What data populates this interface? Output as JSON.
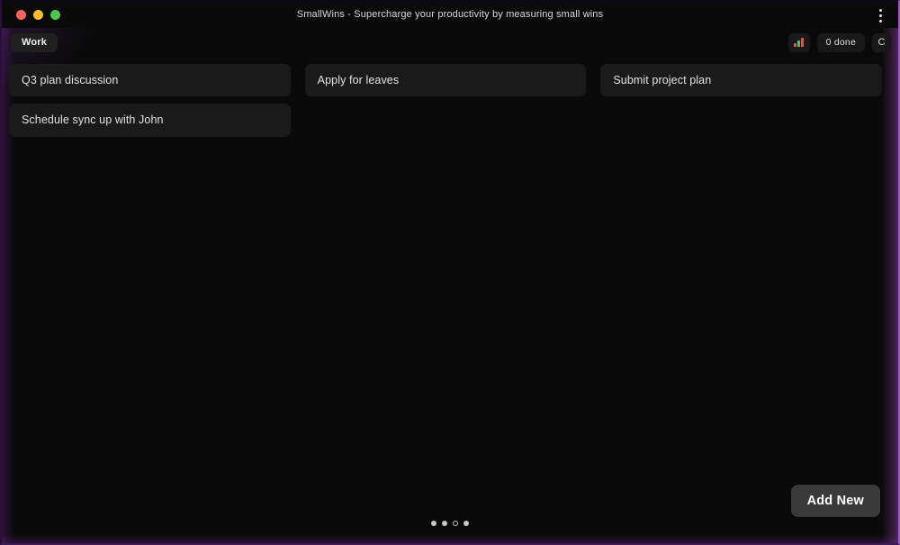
{
  "window": {
    "title": "SmallWins - Supercharge your productivity by measuring small wins",
    "traffic_lights": [
      {
        "name": "close",
        "color": "#f4645f"
      },
      {
        "name": "minimize",
        "color": "#fbbd2e"
      },
      {
        "name": "maximize",
        "color": "#4cc94d"
      }
    ],
    "menu_icon": "kebab-menu-icon"
  },
  "toolbar": {
    "tabs": [
      {
        "label": "Work",
        "active": true
      }
    ],
    "stats_icon": "bar-chart-icon",
    "done_badge": "0 done",
    "avatar_label": "C"
  },
  "board": {
    "columns": [
      {
        "cards": [
          {
            "title": "Q3 plan discussion"
          },
          {
            "title": "Schedule sync up with John"
          }
        ]
      },
      {
        "cards": [
          {
            "title": "Apply for leaves"
          }
        ]
      },
      {
        "cards": [
          {
            "title": "Submit project plan"
          }
        ]
      }
    ]
  },
  "footer": {
    "add_new_label": "Add New",
    "pager_dots": [
      {
        "filled": true
      },
      {
        "filled": true
      },
      {
        "filled": false
      },
      {
        "filled": true
      }
    ]
  },
  "colors": {
    "window_background": "#0a0a0a",
    "card_background": "#1a1a1a",
    "accent_glow": "#a259c8",
    "text_primary": "#e2e2e2",
    "button_background": "#3a3a3a"
  }
}
